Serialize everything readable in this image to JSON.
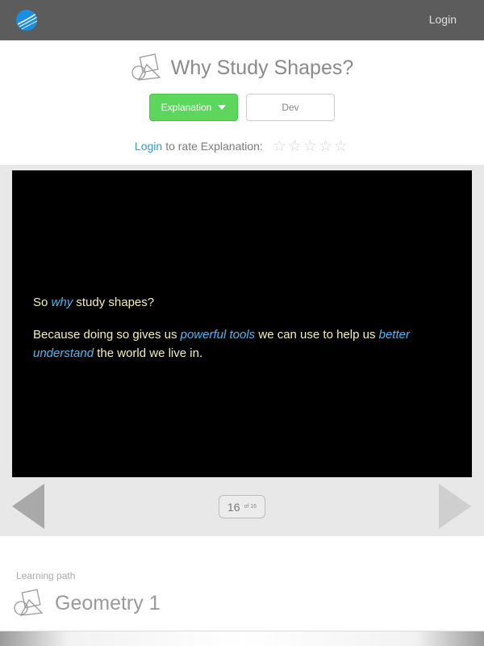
{
  "topbar": {
    "logo_icon": "globe-swoosh-icon",
    "login_label": "Login"
  },
  "header": {
    "title": "Why Study Shapes?",
    "title_icon": "shapes-icon",
    "explanation_button": "Explanation",
    "dev_button": "Dev",
    "rate": {
      "login_link": "Login",
      "text": "to rate Explanation:",
      "star_glyph": "☆",
      "rating": 0,
      "max": 5
    }
  },
  "slide": {
    "line1": {
      "a": "So ",
      "b": "why",
      "c": " study shapes?"
    },
    "line2": {
      "a": "Because doing so gives us ",
      "b": "powerful tools",
      "c": " we can use to help us ",
      "d": "better understand",
      "e": " the world we live in."
    }
  },
  "pager": {
    "current": "16",
    "of_label": "of 16"
  },
  "learning_path": {
    "label": "Learning path",
    "title": "Geometry 1",
    "icon": "shapes-icon"
  },
  "colors": {
    "topbar": "#5c5c5c",
    "accent_green": "#5cd65c",
    "link_blue": "#2a9fd6",
    "slide_text": "#f5f0b8",
    "slide_highlight": "#58b4f0"
  }
}
